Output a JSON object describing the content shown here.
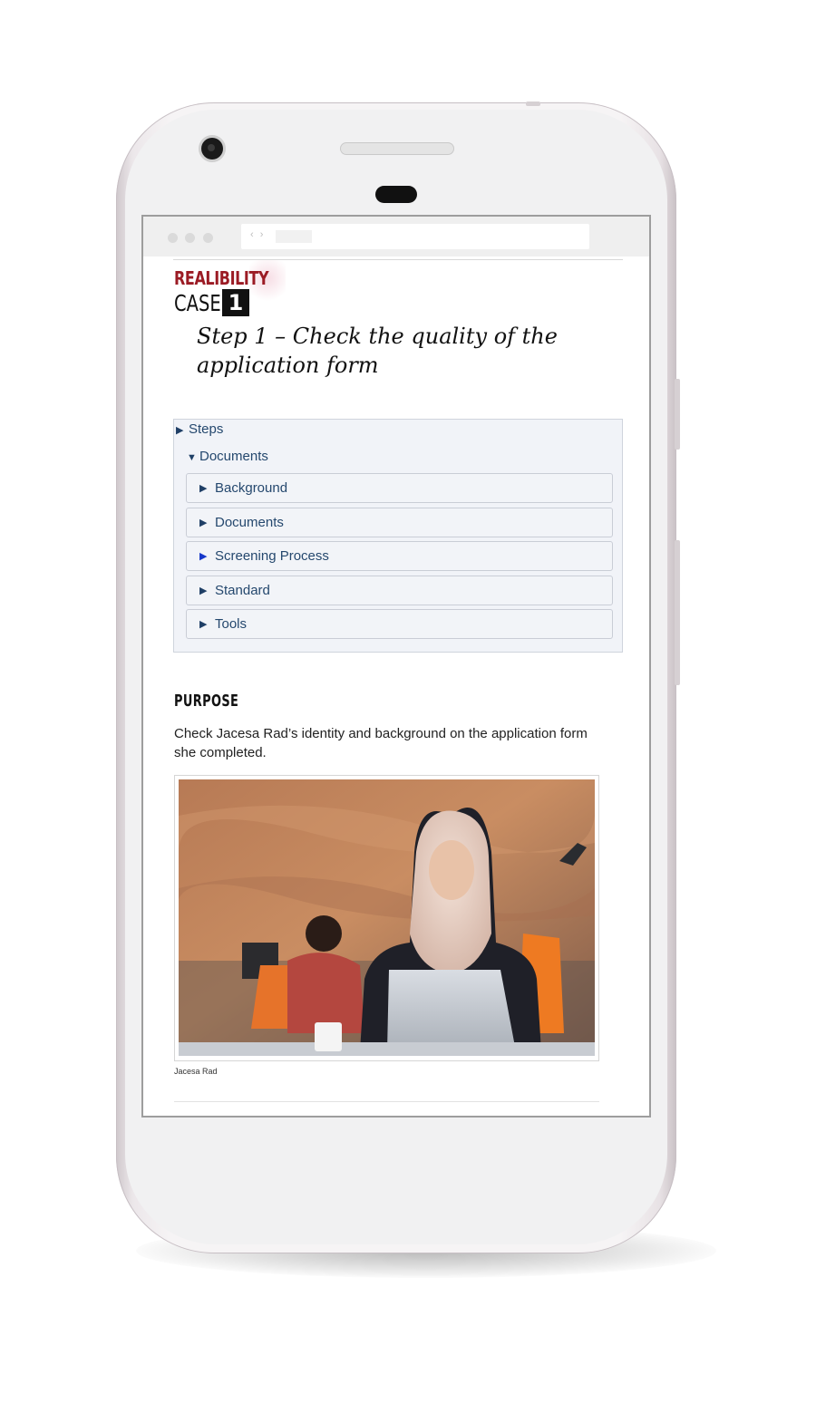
{
  "header": {
    "logo_top": "REALIBILITY",
    "logo_bottom": "CASE",
    "logo_number": "1",
    "step_title": "Step 1 – Check the quality of the application form"
  },
  "accordion": {
    "steps_label": "Steps",
    "documents_label": "Documents",
    "items": [
      {
        "label": "Background"
      },
      {
        "label": "Documents"
      },
      {
        "label": "Screening Process"
      },
      {
        "label": "Standard"
      },
      {
        "label": "Tools"
      }
    ]
  },
  "purpose": {
    "heading": "PURPOSE",
    "text": "Check Jacesa Rad’s identity and background on the application form she completed."
  },
  "image": {
    "caption": "Jacesa Rad"
  }
}
